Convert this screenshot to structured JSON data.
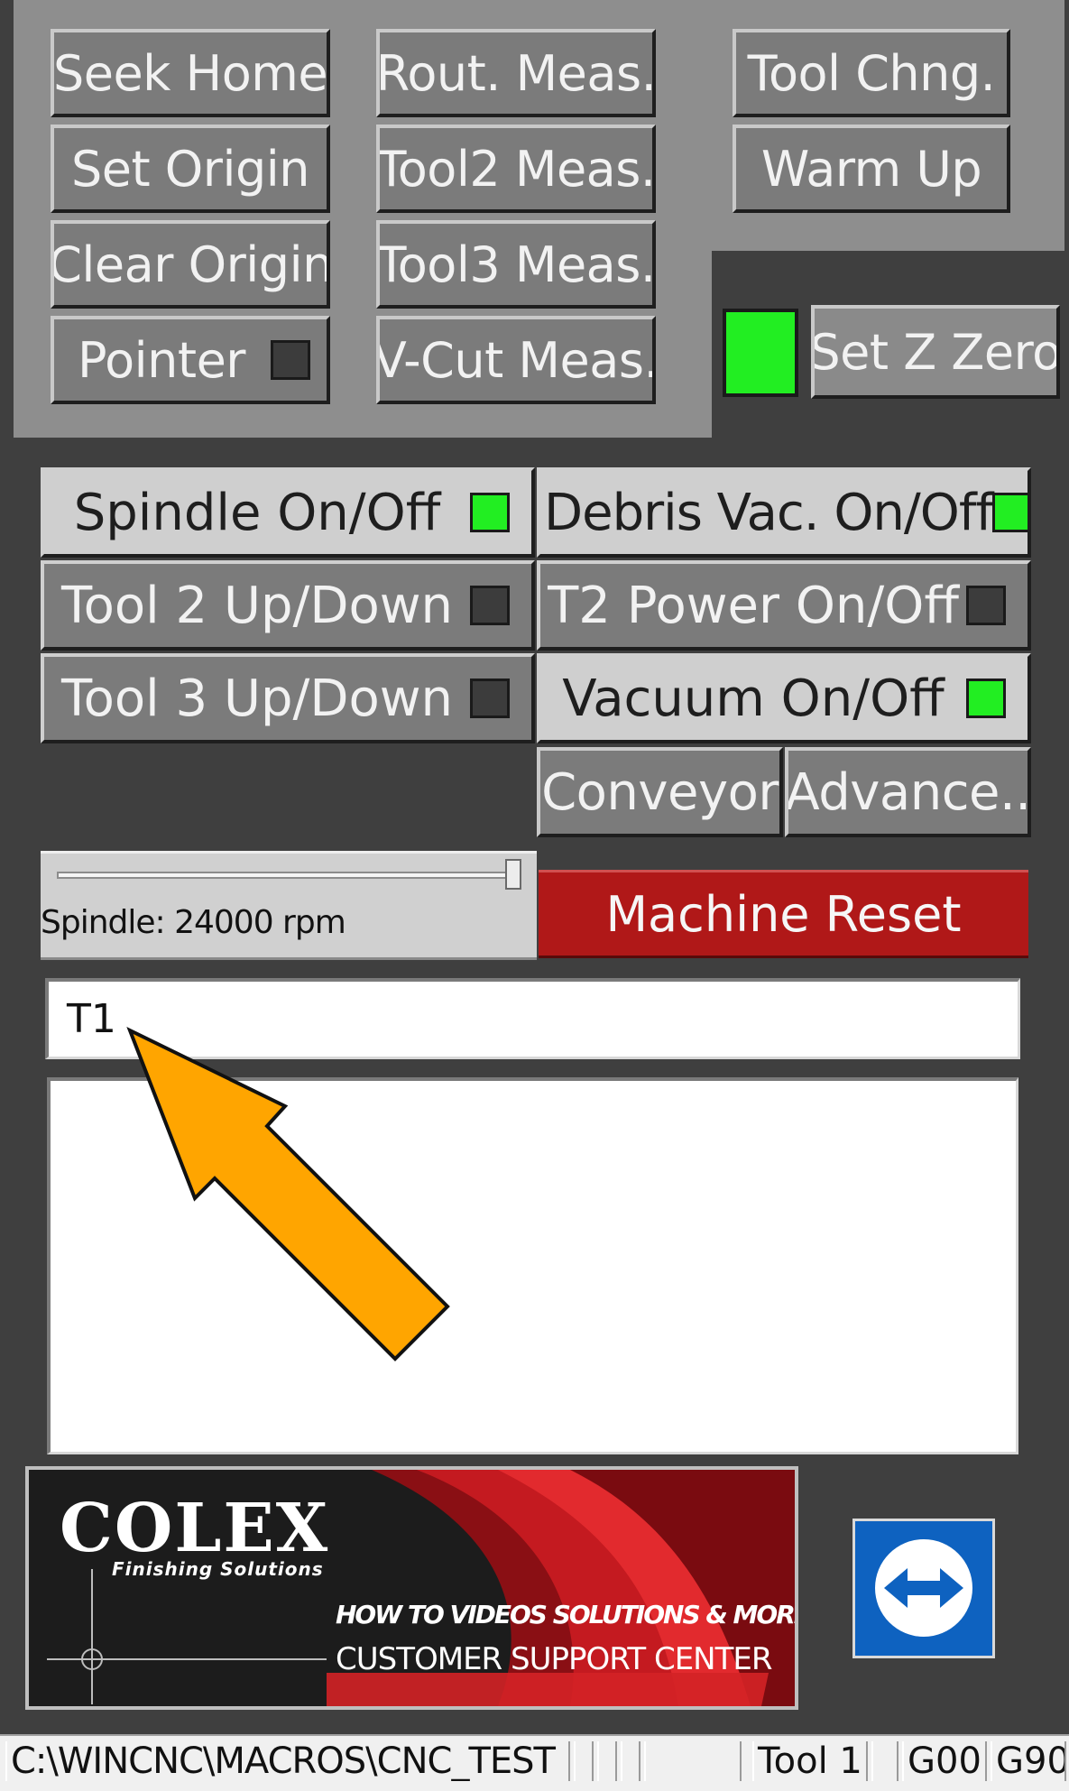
{
  "top_buttons": {
    "seek_home": "Seek Home",
    "set_origin": "Set Origin",
    "clear_origin": "Clear Origin",
    "pointer": "Pointer",
    "rout_meas": "Rout. Meas.",
    "tool2_meas": "Tool2 Meas.",
    "tool3_meas": "Tool3 Meas.",
    "vcut_meas": "V-Cut Meas.",
    "tool_chng": "Tool Chng.",
    "warm_up": "Warm Up",
    "set_z_zero": "Set Z Zero"
  },
  "indicators": {
    "pointer": "off",
    "z_zero": "on"
  },
  "toggles": {
    "spindle": {
      "label": "Spindle On/Off",
      "state": "on"
    },
    "debris_vac": {
      "label": "Debris Vac. On/Off",
      "state": "on"
    },
    "tool2_updown": {
      "label": "Tool 2 Up/Down",
      "state": "off"
    },
    "t2_power": {
      "label": "T2 Power On/Off",
      "state": "off"
    },
    "tool3_updown": {
      "label": "Tool 3 Up/Down",
      "state": "off"
    },
    "vacuum": {
      "label": "Vacuum On/Off",
      "state": "on"
    }
  },
  "conveyor": {
    "conveyor_label": "Conveyor",
    "advance_label": "Advance.."
  },
  "spindle_slider": {
    "label": "Spindle: 24000 rpm",
    "value_fraction": 1.0
  },
  "machine_reset": "Machine Reset",
  "command_input": {
    "value": "T1"
  },
  "log_area": {
    "text": ""
  },
  "banner": {
    "brand": "COLEX",
    "tagline": "Finishing Solutions",
    "line1": "HOW TO VIDEOS SOLUTIONS & MORE",
    "line2": "CUSTOMER SUPPORT CENTER"
  },
  "status_bar": {
    "path": "C:\\WINCNC\\MACROS\\CNC_TEST",
    "tool": "Tool 1",
    "mode1": "G00",
    "mode2": "G90"
  },
  "colors": {
    "background": "#3f3f3f",
    "button": "#7b7b7b",
    "indicator_on": "#22ee22",
    "reset": "#b01818",
    "arrow": "#ffa500",
    "teamviewer": "#0e62c0"
  },
  "icons": {
    "remote": "teamviewer-icon",
    "arrow": "callout-arrow"
  }
}
